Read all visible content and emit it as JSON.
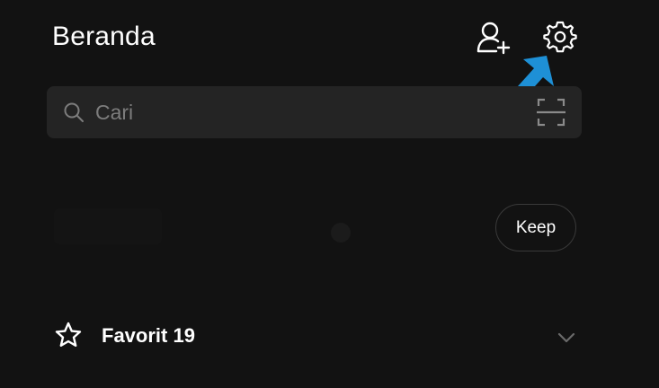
{
  "header": {
    "title": "Beranda",
    "add_friend_icon": "add-friend-icon",
    "settings_icon": "gear-icon"
  },
  "search": {
    "placeholder": "Cari",
    "icon": "search-icon",
    "scan_icon": "scan-icon"
  },
  "banner": {
    "keep_label": "Keep"
  },
  "favorites": {
    "icon": "star-icon",
    "label": "Favorit 19",
    "expand_icon": "chevron-down-icon"
  },
  "annotation": {
    "arrow_color": "#1e90d6"
  },
  "colors": {
    "background": "#121212",
    "search_bg": "#242424",
    "placeholder": "#7d7d7d"
  }
}
